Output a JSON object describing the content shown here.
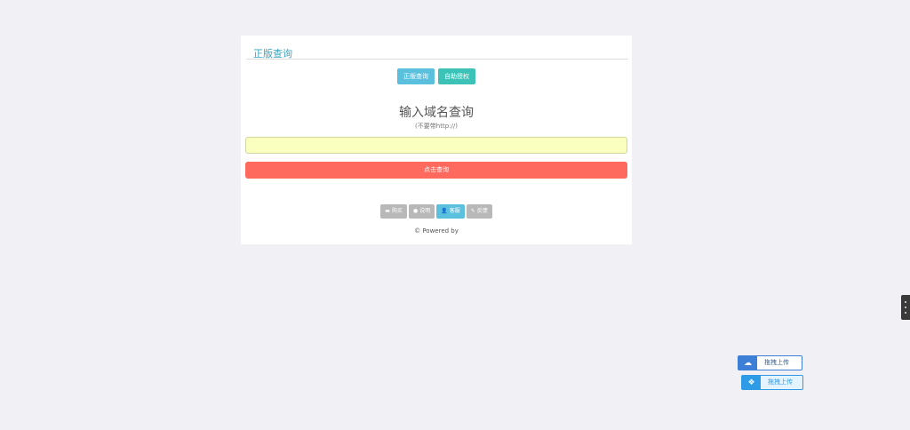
{
  "panel": {
    "title": "正版查询",
    "tabs": [
      {
        "label": "正版查询"
      },
      {
        "label": "自助授权"
      }
    ],
    "heading": "输入域名查询",
    "subheading": "(不要带http://)",
    "input": {
      "value": "",
      "placeholder": ""
    },
    "submit_label": "点击查询",
    "footer_buttons": [
      {
        "label": "购买",
        "icon": "image-icon"
      },
      {
        "label": "说明",
        "icon": "info-icon"
      },
      {
        "label": "客服",
        "icon": "user-icon"
      },
      {
        "label": "反馈",
        "icon": "pencil-icon"
      }
    ],
    "powered_by": "© Powered by"
  },
  "widgets": {
    "upload_1_label": "拖拽上传",
    "upload_2_label": "拖拽上传"
  },
  "colors": {
    "query_tab": "#5bc0de",
    "auth_tab": "#3dc2b8",
    "submit": "#ff6a5e",
    "input_bg": "#fafebe",
    "accent_blue": "#3d7fd6"
  }
}
